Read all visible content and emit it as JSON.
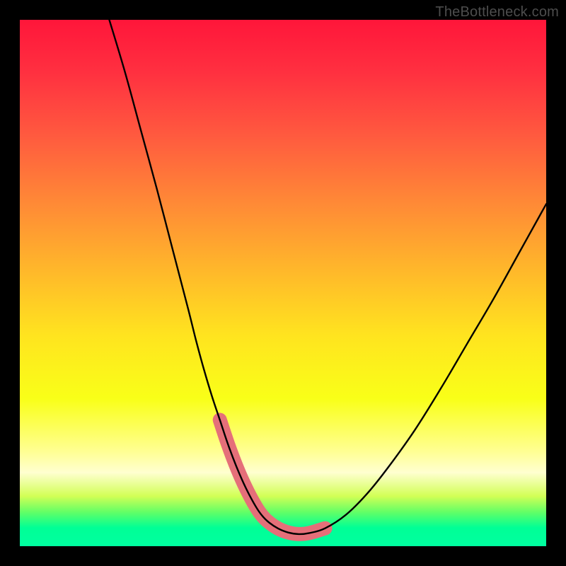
{
  "watermark": {
    "text": "TheBottleneck.com"
  },
  "colors": {
    "frame": "#000000",
    "curve": "#000000",
    "accent": "#e56f79",
    "gradient_stops": [
      {
        "offset": 0.0,
        "color": "#ff163a"
      },
      {
        "offset": 0.1,
        "color": "#ff3040"
      },
      {
        "offset": 0.22,
        "color": "#ff5a3f"
      },
      {
        "offset": 0.35,
        "color": "#ff8a36"
      },
      {
        "offset": 0.48,
        "color": "#ffb92a"
      },
      {
        "offset": 0.6,
        "color": "#ffe41f"
      },
      {
        "offset": 0.72,
        "color": "#f9ff18"
      },
      {
        "offset": 0.82,
        "color": "#ffff93"
      },
      {
        "offset": 0.86,
        "color": "#ffffd0"
      },
      {
        "offset": 0.905,
        "color": "#d2ff55"
      },
      {
        "offset": 0.935,
        "color": "#63ff66"
      },
      {
        "offset": 0.965,
        "color": "#00ff96"
      },
      {
        "offset": 1.0,
        "color": "#00ffa0"
      }
    ]
  },
  "chart_data": {
    "type": "line",
    "title": "",
    "xlabel": "",
    "ylabel": "",
    "xlim": [
      0,
      100
    ],
    "ylim": [
      0,
      100
    ],
    "series": [
      {
        "name": "bottleneck-curve",
        "x": [
          17,
          20,
          23,
          26,
          29,
          32,
          33.5,
          35,
          36.5,
          38,
          39.5,
          41,
          42.5,
          44,
          45.5,
          47,
          49,
          51,
          53,
          55,
          58,
          62,
          66,
          70,
          75,
          80,
          85,
          90,
          95,
          100
        ],
        "values": [
          100,
          90,
          79,
          68,
          56.5,
          45,
          39,
          33.5,
          28.5,
          24,
          19.5,
          15.5,
          12,
          9,
          6.5,
          4.8,
          3.4,
          2.6,
          2.3,
          2.5,
          3.4,
          6,
          10,
          15,
          22,
          30,
          38.5,
          47,
          56,
          65
        ]
      }
    ],
    "accent_segment": {
      "x": [
        38,
        39.5,
        41,
        42.5,
        44,
        45.5,
        47,
        49,
        51,
        53,
        55,
        58
      ],
      "values": [
        24,
        19.5,
        15.5,
        12,
        9,
        6.5,
        4.8,
        3.4,
        2.6,
        2.3,
        2.5,
        3.4
      ]
    },
    "annotations": []
  }
}
